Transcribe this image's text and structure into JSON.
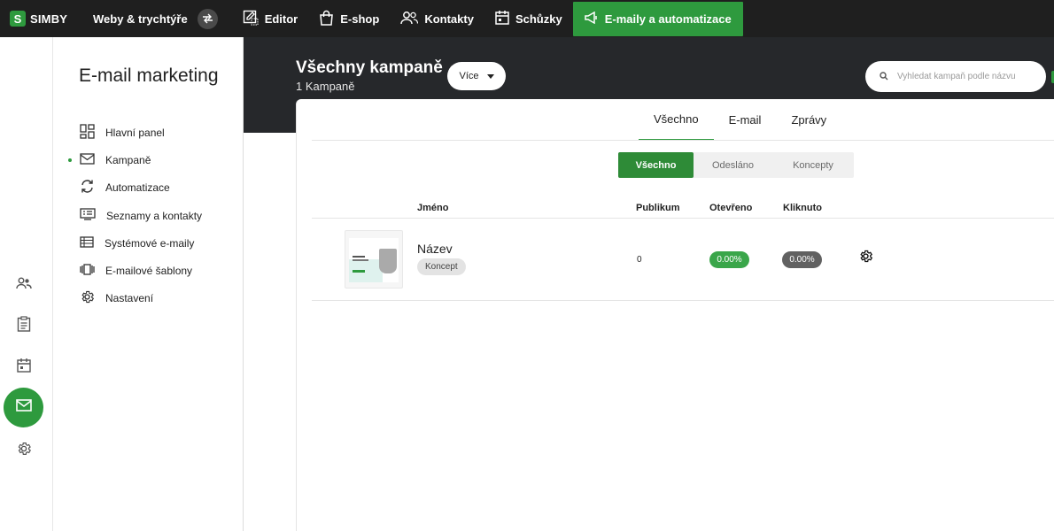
{
  "topnav": {
    "logo_mark": "S",
    "logo_text": "SIMBY",
    "sites_label": "Weby & trychtýře",
    "items": [
      {
        "label": "Editor",
        "icon": "editor-icon"
      },
      {
        "label": "E-shop",
        "icon": "shopping-bag-icon"
      },
      {
        "label": "Kontakty",
        "icon": "contacts-icon"
      },
      {
        "label": "Schůzky",
        "icon": "calendar-icon"
      },
      {
        "label": "E-maily a automatizace",
        "icon": "megaphone-icon",
        "active": true
      }
    ]
  },
  "sidebar": {
    "title": "E-mail marketing",
    "items": [
      {
        "label": "Hlavní panel",
        "icon": "dashboard-icon"
      },
      {
        "label": "Kampaně",
        "icon": "envelope-icon",
        "active": true
      },
      {
        "label": "Automatizace",
        "icon": "sync-icon"
      },
      {
        "label": "Seznamy a kontakty",
        "icon": "list-icon"
      },
      {
        "label": "Systémové e-maily",
        "icon": "system-mail-icon"
      },
      {
        "label": "E-mailové šablony",
        "icon": "template-icon"
      },
      {
        "label": "Nastavení",
        "icon": "gear-icon"
      }
    ]
  },
  "header": {
    "title": "Všechny kampaně",
    "subtitle": "1 Kampaně",
    "more_label": "Více",
    "search_placeholder": "Vyhledat kampaň podle názvu"
  },
  "tabs": [
    {
      "label": "Všechno",
      "active": true
    },
    {
      "label": "E-mail"
    },
    {
      "label": "Zprávy"
    }
  ],
  "filters": [
    {
      "label": "Všechno",
      "active": true
    },
    {
      "label": "Odesláno"
    },
    {
      "label": "Koncepty"
    }
  ],
  "table": {
    "columns": [
      "Jméno",
      "Publikum",
      "Otevřeno",
      "Kliknuto"
    ],
    "rows": [
      {
        "name": "Název",
        "status": "Koncept",
        "audience": "0",
        "opened": "0.00%",
        "clicked": "0.00%"
      }
    ]
  },
  "colors": {
    "accent": "#2e9a3e",
    "topbar": "#1f1f1f",
    "header": "#26282b"
  }
}
